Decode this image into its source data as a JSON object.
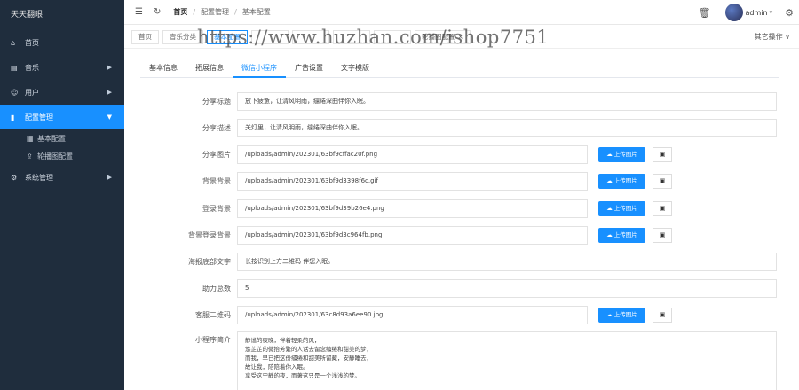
{
  "app": {
    "title": "天天翻眼"
  },
  "sidebar": {
    "items": [
      {
        "icon": "home-icon",
        "glyph": "⌂",
        "label": "首页"
      },
      {
        "icon": "music-icon",
        "glyph": "▤",
        "label": "音乐"
      },
      {
        "icon": "user-icon",
        "glyph": "☺",
        "label": "用户"
      },
      {
        "icon": "chart-icon",
        "glyph": "▮",
        "label": "配置管理"
      },
      {
        "icon": "settings-icon",
        "glyph": "⚙",
        "label": "系统管理"
      }
    ],
    "sub_items": [
      {
        "icon": "grid-icon",
        "glyph": "▦",
        "label": "基本配置"
      },
      {
        "icon": "upload-icon",
        "glyph": "⇪",
        "label": "轮播图配置"
      }
    ]
  },
  "header": {
    "breadcrumb": [
      "首页",
      "配置管理",
      "基本配置"
    ],
    "user": "admin"
  },
  "tags": {
    "items": [
      "首页",
      "音乐分类",
      "基本配置",
      "",
      "",
      "",
      "",
      "轮播图配置"
    ],
    "other_ops": "其它操作"
  },
  "watermark": "https://www.huzhan.com/ishop7751",
  "tabs": [
    "基本信息",
    "拓展信息",
    "微信小程序",
    "广告设置",
    "文字模版"
  ],
  "form": {
    "share_title": {
      "label": "分享标题",
      "value": "放下疲惫，让清风明雨，缱绻深曲伴你入眠。"
    },
    "share_desc": {
      "label": "分享描述",
      "value": "关灯里，让清风明雨，缱绻深曲伴你入眠。"
    },
    "share_image": {
      "label": "分享图片",
      "value": "/uploads/admin/202301/63bf9cffac20f.png"
    },
    "bg_image": {
      "label": "背景背景",
      "value": "/uploads/admin/202301/63bf9d3398f6c.gif"
    },
    "login_bg": {
      "label": "登录背景",
      "value": "/uploads/admin/202301/63bf9d39b26e4.png"
    },
    "bg_login_bg": {
      "label": "背景登录背景",
      "value": "/uploads/admin/202301/63bf9d3c964fb.png"
    },
    "poster_text": {
      "label": "海报底部文字",
      "value": "长按识别上方二维码 伴您入眠。"
    },
    "help_count": {
      "label": "助力总数",
      "value": "5"
    },
    "service_qr": {
      "label": "客服二维码",
      "value": "/uploads/admin/202301/63c8d93a6ee90.jpg"
    },
    "intro": {
      "label": "小程序简介",
      "lines": [
        "静谧的夜晚，伴着轻柔的风，",
        "悠芷芷的微抬芳繁的人话去留念缱绻和甜美的梦，",
        "而我，早已把这份缱绻和甜美所留藏，安静睡去，",
        "故让我，陪陪着你入眠。",
        "享受这宁静的夜，而著这只是一个浅浅的梦。"
      ]
    },
    "upload_label": "上传图片"
  }
}
